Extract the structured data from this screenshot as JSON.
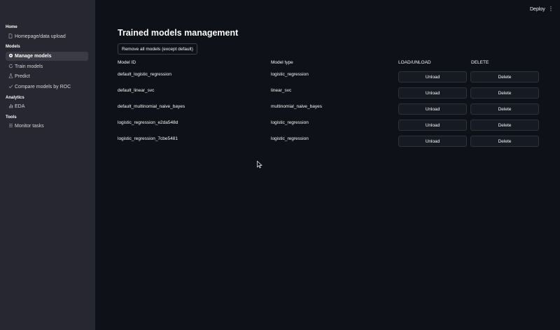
{
  "sidebar": {
    "sections": [
      {
        "title": "Home",
        "items": [
          {
            "label": "Homepage/data upload",
            "icon": "document-icon"
          }
        ]
      },
      {
        "title": "Models",
        "items": [
          {
            "label": "Manage models",
            "icon": "gear-icon",
            "active": true
          },
          {
            "label": "Train models",
            "icon": "refresh-icon"
          },
          {
            "label": "Predict",
            "icon": "flask-icon"
          },
          {
            "label": "Compare models by ROC",
            "icon": "checkmark-icon"
          }
        ]
      },
      {
        "title": "Analytics",
        "items": [
          {
            "label": "EDA",
            "icon": "bar-chart-icon"
          }
        ]
      },
      {
        "title": "Tools",
        "items": [
          {
            "label": "Monitor tasks",
            "icon": "list-icon"
          }
        ]
      }
    ]
  },
  "topbar": {
    "deploy_label": "Deploy",
    "menu_icon": "⋮"
  },
  "main": {
    "title": "Trained models management",
    "remove_all_label": "Remove all models (except default)",
    "columns": [
      "Model ID",
      "Model type",
      "LOAD/UNLOAD",
      "DELETE"
    ],
    "rows": [
      {
        "id": "default_logistic_regression",
        "type": "logistic_regression",
        "load_label": "Unload",
        "delete_label": "Delete"
      },
      {
        "id": "default_linear_svc",
        "type": "linear_svc",
        "load_label": "Unload",
        "delete_label": "Delete"
      },
      {
        "id": "default_multinomial_naive_bayes",
        "type": "multinomial_naive_bayes",
        "load_label": "Unload",
        "delete_label": "Delete"
      },
      {
        "id": "logistic_regression_e2da548d",
        "type": "logistic_regression",
        "load_label": "Unload",
        "delete_label": "Delete"
      },
      {
        "id": "logistic_regression_7cbe5481",
        "type": "logistic_regression",
        "load_label": "Unload",
        "delete_label": "Delete"
      }
    ]
  },
  "colors": {
    "background": "#0e1117",
    "sidebar": "#262730",
    "active_item": "#3a3b45",
    "text": "#fafafa"
  }
}
